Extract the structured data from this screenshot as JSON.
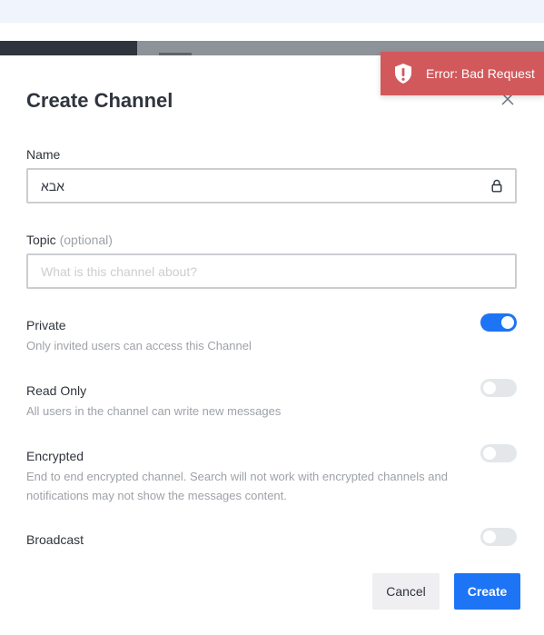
{
  "modal": {
    "title": "Create Channel",
    "name": {
      "label": "Name",
      "value": "אבא"
    },
    "topic": {
      "label": "Topic",
      "optional": "(optional)",
      "placeholder": "What is this channel about?"
    },
    "options": [
      {
        "label": "Private",
        "description": "Only invited users can access this Channel",
        "enabled": true
      },
      {
        "label": "Read Only",
        "description": "All users in the channel can write new messages",
        "enabled": false
      },
      {
        "label": "Encrypted",
        "description": "End to end encrypted channel. Search will not work with encrypted channels and notifications may not show the messages content.",
        "enabled": false
      },
      {
        "label": "Broadcast",
        "enabled": false
      }
    ],
    "buttons": {
      "cancel": "Cancel",
      "create": "Create"
    }
  },
  "toast": {
    "text": "Error: Bad Request"
  },
  "icons": {
    "close": "close-icon",
    "lock": "lock-icon",
    "alert": "alert-shield-icon"
  },
  "colors": {
    "accent": "#1d74f5",
    "error": "#d1595c",
    "muted": "#9ea2a8"
  }
}
